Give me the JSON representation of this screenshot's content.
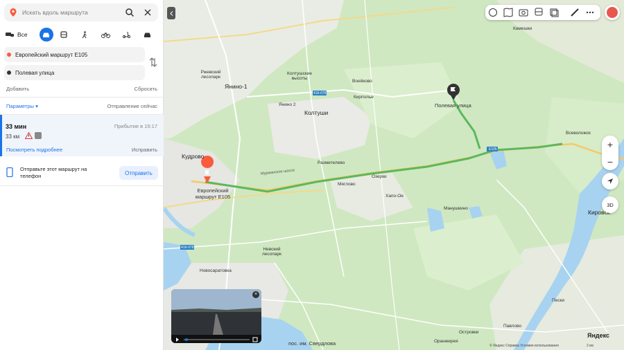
{
  "search": {
    "placeholder": "Искать вдоль маршрута"
  },
  "modes": {
    "all_label": "Все"
  },
  "route": {
    "from": "Европейский маршрут E105",
    "to": "Полевая улица",
    "add": "Добавить",
    "reset": "Сбросить",
    "params": "Параметры ▾",
    "depart": "Отправление сейчас"
  },
  "result": {
    "duration": "33 мин",
    "arrival": "Прибытие в 15:17",
    "distance": "33 км",
    "details": "Посмотреть подробнее",
    "fix": "Исправить"
  },
  "send": {
    "text": "Отправьте этот маршрут на телефон",
    "button": "Отправить"
  },
  "map": {
    "labels": {
      "kudrovo": "Кудрово",
      "yanino1": "Янино-1",
      "koltushi": "Колтуши",
      "yanino2": "Янино 2",
      "polevaya": "Полевая улица",
      "e105": "Европейский маршрут Е105",
      "razmetelevo": "Разметелево",
      "ozerki": "Озерки",
      "hapo": "Хапо-Ое",
      "manushkino": "Манушкино",
      "voeikovo": "Воейково",
      "kirpolye": "Кирполье",
      "kirovsk": "Кировск",
      "pavlovo": "Павлово",
      "pesky": "Пески",
      "nevsky_park": "Невский лесопарк",
      "rzhevsky_park": "Ржевский лесопарк",
      "koltush_heights": "Колтушские высоты",
      "novosaratovka": "Новосаратовка",
      "sverdlova": "пос. им. Свердлова",
      "murmanskoe": "Мурманское шоссе",
      "vsevolozhsk": "Всеволожск",
      "kameshki": "Камешки",
      "orangerea": "Оранжерея",
      "mgle": "Мяглово",
      "ostrovki": "Островки"
    },
    "road_badges": {
      "a": "41К-078",
      "b": "41К-078",
      "c": "Е105"
    }
  },
  "branding": {
    "logo": "Яндекс",
    "copyright": "© Яндекс  Справка  Условия использования",
    "scale": "2 км"
  },
  "colors": {
    "route": "#5cb85c",
    "accent": "#1a73e8",
    "start_pin": "#fa5b3d",
    "end_pin": "#333333",
    "water": "#a7d3f0",
    "forest": "#c5e3b4",
    "urban": "#ececec"
  }
}
